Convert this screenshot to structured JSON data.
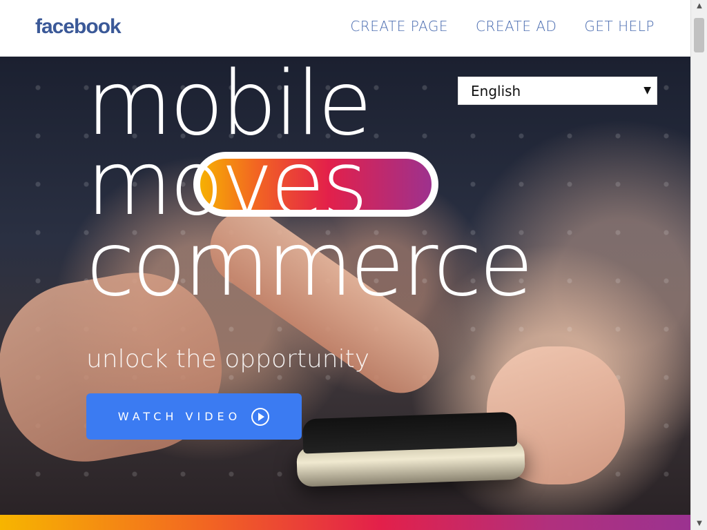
{
  "header": {
    "logo": "facebook",
    "nav": [
      {
        "label": "CREATE PAGE"
      },
      {
        "label": "CREATE AD"
      },
      {
        "label": "GET HELP"
      }
    ]
  },
  "hero": {
    "headline_lines": [
      "mobile",
      "moves",
      "commerce"
    ],
    "tagline": "unlock the opportunity",
    "watch_button": "WATCH VIDEO",
    "language_select": {
      "selected": "English"
    }
  },
  "colors": {
    "brand_blue": "#3b5998",
    "nav_blue": "#4a6cb0",
    "button_blue": "#3b7bf2",
    "gradient_start": "#f7b500",
    "gradient_mid": "#e3204a",
    "gradient_end": "#9b3290"
  },
  "icons": {
    "play": "play-circle-icon",
    "dropdown": "chevron-down-icon"
  }
}
